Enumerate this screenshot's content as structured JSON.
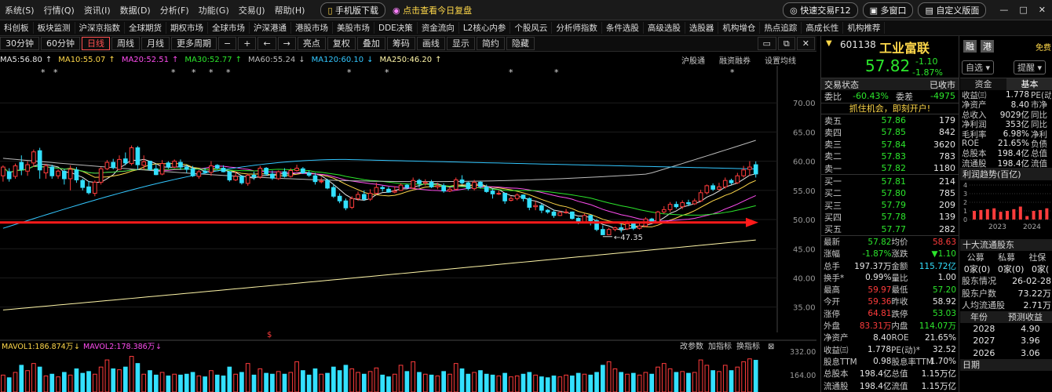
{
  "menubar": {
    "items": [
      "系统(S)",
      "行情(Q)",
      "资讯(I)",
      "数据(D)",
      "分析(F)",
      "功能(G)",
      "交易(J)",
      "帮助(H)"
    ],
    "mobile": "手机版下载",
    "review": "点击查看今日复盘",
    "quick_trade": "快速交易F12",
    "multi_window": "多窗口",
    "custom_layout": "自定义版面"
  },
  "navbar": {
    "items": [
      "科创板",
      "板块监测",
      "沪深京指数",
      "全球期货",
      "期权市场",
      "全球市场",
      "沪深港通",
      "港股市场",
      "美股市场",
      "DDE决策",
      "资金流向",
      "L2核心内参",
      "个股风云",
      "分析师指数",
      "条件选股",
      "高级选股",
      "选股器",
      "机构增仓",
      "热点追踪",
      "高成长性",
      "机构推荐"
    ]
  },
  "toolbar": {
    "periods": [
      "30分钟",
      "60分钟",
      "日线",
      "周线",
      "月线",
      "更多周期"
    ],
    "selected": "日线",
    "tools": [
      "亮点",
      "复权",
      "叠加",
      "筹码",
      "画线",
      "显示",
      "简约",
      "隐藏"
    ]
  },
  "ma_legend": [
    {
      "label": "MA5:56.80",
      "color": "#e6e6e6",
      "arrow": "↑"
    },
    {
      "label": "MA10:55.07",
      "color": "#ffd84a",
      "arrow": "↑"
    },
    {
      "label": "MA20:52.51",
      "color": "#ff4df0",
      "arrow": "↑"
    },
    {
      "label": "MA30:52.77",
      "color": "#2ce62c",
      "arrow": "↑"
    },
    {
      "label": "MA60:55.24",
      "color": "#bbbbbb",
      "arrow": "↓"
    },
    {
      "label": "MA120:60.10",
      "color": "#33c7ff",
      "arrow": "↓"
    },
    {
      "label": "MA250:46.20",
      "color": "#fff6a8",
      "arrow": "↑"
    }
  ],
  "chart_links": [
    "沪股通",
    "融资融券",
    "设置均线"
  ],
  "vol_legend": [
    {
      "label": "MAVOL1:186.874万",
      "color": "#ffd84a",
      "arrow": "↓"
    },
    {
      "label": "MAVOL2:178.386万",
      "color": "#ff4df0",
      "arrow": "↓"
    }
  ],
  "vol_tools": [
    "改参数",
    "加指标",
    "换指标"
  ],
  "chart_data": {
    "type": "candlestick",
    "price_axis": {
      "ticks": [
        "70.00",
        "65.00",
        "60.00",
        "55.00",
        "50.00",
        "45.00",
        "40.00",
        "35.00"
      ],
      "range": [
        32,
        75
      ]
    },
    "vol_axis": {
      "ticks": [
        "332.00",
        "164.00"
      ]
    },
    "min_label": "47.35",
    "horizontal_line": 49.5,
    "candles": [
      [
        57.5,
        59,
        56.5,
        59.3
      ],
      [
        58.2,
        57,
        56.5,
        58.8
      ],
      [
        57.4,
        59.2,
        57,
        59.6
      ],
      [
        59.8,
        58.6,
        57.6,
        61
      ],
      [
        58.3,
        59.4,
        57.5,
        60
      ],
      [
        59.7,
        61.6,
        59,
        62
      ],
      [
        61.8,
        58.5,
        57,
        62.3
      ],
      [
        58,
        59.2,
        57,
        59.5
      ],
      [
        59,
        57.5,
        57,
        59.4
      ],
      [
        57.5,
        58.3,
        57,
        58.6
      ],
      [
        58.3,
        57,
        56,
        58.7
      ],
      [
        57,
        58.6,
        55,
        59.3
      ],
      [
        58.5,
        56.8,
        56.3,
        59
      ],
      [
        56.7,
        55.5,
        55,
        57
      ],
      [
        55.6,
        54.6,
        54.3,
        56.6
      ],
      [
        54.5,
        56.4,
        54,
        56.7
      ],
      [
        56.4,
        58.7,
        56,
        59
      ],
      [
        58.7,
        59.8,
        58.5,
        60.2
      ],
      [
        59.8,
        58.9,
        58.6,
        60.4
      ],
      [
        58.6,
        60.3,
        58.5,
        61
      ],
      [
        60.4,
        59.7,
        59.3,
        61.5
      ],
      [
        59.6,
        62.3,
        59.3,
        62.7
      ],
      [
        62.3,
        59.4,
        58.6,
        62.6
      ],
      [
        59.3,
        59.9,
        58.5,
        61
      ],
      [
        60,
        58.6,
        58.4,
        60.1
      ],
      [
        58.7,
        57.7,
        57.6,
        59.5
      ],
      [
        57.8,
        59.6,
        57.6,
        60.2
      ],
      [
        59.7,
        59,
        58.7,
        60
      ],
      [
        59,
        60,
        58.8,
        60.3
      ],
      [
        59.8,
        59,
        58.5,
        60.3
      ],
      [
        59,
        58.6,
        58,
        59.4
      ],
      [
        58.7,
        57.5,
        57.3,
        59.2
      ],
      [
        57.4,
        58.2,
        57,
        58.5
      ],
      [
        58.3,
        58.1,
        57.9,
        58.9
      ],
      [
        58.1,
        59.2,
        57.5,
        60
      ],
      [
        59.3,
        58.8,
        58.6,
        59.5
      ],
      [
        58.8,
        58.2,
        58.1,
        59.3
      ],
      [
        58.2,
        56.8,
        56.5,
        58.3
      ],
      [
        56.8,
        57.4,
        56.6,
        58.2
      ],
      [
        57.4,
        56.3,
        56,
        57.6
      ],
      [
        56.2,
        57.6,
        55.8,
        57.8
      ],
      [
        57.6,
        57.3,
        56.8,
        58.2
      ],
      [
        57.3,
        58.8,
        57,
        59.2
      ],
      [
        58.8,
        57.8,
        57.5,
        59
      ],
      [
        57.8,
        57.1,
        56.8,
        58.4
      ],
      [
        57,
        58.2,
        56.8,
        58.4
      ],
      [
        58.2,
        57.4,
        57.2,
        58.8
      ],
      [
        57.4,
        58.4,
        57.2,
        58.8
      ],
      [
        58.4,
        58.8,
        58.2,
        59.4
      ],
      [
        58.7,
        58,
        57.8,
        59
      ],
      [
        58,
        57.6,
        57.3,
        58.4
      ],
      [
        57.5,
        56.5,
        56,
        58
      ],
      [
        56.6,
        56.6,
        56.2,
        57.2
      ],
      [
        56.7,
        55.4,
        55.2,
        57
      ],
      [
        55.5,
        54,
        53.7,
        56
      ],
      [
        54,
        53.2,
        52.8,
        54.5
      ],
      [
        53.2,
        52,
        51.6,
        53.6
      ],
      [
        52.1,
        53.6,
        51.8,
        54
      ],
      [
        53.6,
        54.3,
        53.2,
        54.8
      ],
      [
        54.3,
        53.5,
        53.2,
        55
      ],
      [
        53.5,
        54.5,
        53.2,
        55.2
      ],
      [
        54.5,
        55.5,
        54.3,
        56.3
      ],
      [
        55.5,
        55.3,
        54.8,
        55.8
      ],
      [
        55.2,
        54.7,
        54.6,
        55.6
      ],
      [
        54.7,
        54.9,
        54.5,
        55.7
      ],
      [
        55,
        55.9,
        54.9,
        56.2
      ],
      [
        55.9,
        55.5,
        55.2,
        56.1
      ],
      [
        55.4,
        56.7,
        55.3,
        57.2
      ],
      [
        56.7,
        56.2,
        55.5,
        57
      ],
      [
        56.2,
        56.4,
        55.8,
        56.9
      ],
      [
        56.4,
        55.6,
        55.4,
        56.8
      ],
      [
        55.6,
        55.8,
        55.2,
        56.3
      ],
      [
        55.8,
        54.9,
        54.6,
        56.2
      ],
      [
        54.9,
        55.2,
        54.7,
        55.6
      ],
      [
        55.2,
        56.8,
        55,
        57.2
      ],
      [
        56.8,
        56.3,
        56,
        57.6
      ],
      [
        56.3,
        55.3,
        55,
        56.5
      ],
      [
        55.3,
        56.4,
        55,
        56.8
      ],
      [
        56.4,
        55.7,
        55.3,
        56.6
      ],
      [
        55.6,
        54.8,
        54.6,
        56
      ],
      [
        54.9,
        54.4,
        53.6,
        55.2
      ],
      [
        54.4,
        54.5,
        54.2,
        55
      ],
      [
        54.5,
        53.2,
        52.7,
        54.6
      ],
      [
        53.3,
        53.6,
        53.1,
        54
      ],
      [
        53.6,
        54.2,
        53.3,
        54.5
      ],
      [
        54.2,
        53.6,
        53.1,
        54.3
      ],
      [
        53.6,
        52.1,
        51.6,
        53.8
      ],
      [
        52.2,
        52.4,
        51.6,
        53.2
      ],
      [
        52.4,
        51.6,
        51.1,
        52.7
      ],
      [
        51.6,
        51.3,
        51,
        51.8
      ],
      [
        51.3,
        50.7,
        50.3,
        51.7
      ],
      [
        50.7,
        51.2,
        50.6,
        51.5
      ],
      [
        51.3,
        51.3,
        51,
        51.8
      ],
      [
        51.3,
        50.2,
        50,
        51.4
      ],
      [
        50.2,
        49.6,
        49.2,
        50.4
      ],
      [
        49.6,
        50.7,
        49.5,
        51
      ],
      [
        50.7,
        49.8,
        49,
        50.8
      ],
      [
        49.8,
        48.3,
        48,
        50.1
      ],
      [
        48.3,
        47.4,
        47.35,
        49
      ],
      [
        47.4,
        48.3,
        47.35,
        48.6
      ],
      [
        48.3,
        48.6,
        48,
        48.8
      ],
      [
        48.6,
        48.4,
        47.8,
        49.4
      ],
      [
        48.4,
        49.3,
        48.2,
        49.8
      ],
      [
        49.3,
        48.5,
        48.2,
        49.6
      ],
      [
        48.5,
        48.9,
        48.3,
        49.4
      ],
      [
        48.9,
        50.1,
        48.7,
        50.4
      ],
      [
        50.1,
        49.6,
        49.3,
        50.3
      ],
      [
        49.6,
        51.3,
        49.4,
        51.5
      ],
      [
        51.3,
        51.7,
        51,
        52.3
      ],
      [
        51.7,
        52.6,
        51.3,
        53
      ],
      [
        52.6,
        52.2,
        51.9,
        53.1
      ],
      [
        52.2,
        52.9,
        51.8,
        53.3
      ],
      [
        52.9,
        52.7,
        52.3,
        53.4
      ],
      [
        52.7,
        53.2,
        52.5,
        53.6
      ],
      [
        53.2,
        54.6,
        53,
        55.1
      ],
      [
        54.6,
        55.8,
        54.3,
        56
      ],
      [
        55.8,
        55.2,
        54.9,
        56.2
      ],
      [
        55.2,
        55.6,
        55,
        56.3
      ],
      [
        55.6,
        56.7,
        55.3,
        57.2
      ],
      [
        56.7,
        56.3,
        56,
        57
      ],
      [
        56.3,
        57.5,
        56.1,
        58
      ],
      [
        57.5,
        58.5,
        57.2,
        59.2
      ],
      [
        58.6,
        59,
        57.5,
        60
      ],
      [
        59.4,
        57.82,
        57.2,
        59.97
      ]
    ],
    "volumes": [
      95,
      80,
      110,
      150,
      120,
      160,
      140,
      90,
      100,
      85,
      110,
      95,
      130,
      105,
      115,
      100,
      140,
      180,
      130,
      125,
      140,
      200,
      160,
      100,
      120,
      95,
      110,
      90,
      100,
      95,
      100,
      110,
      90,
      85,
      120,
      95,
      90,
      140,
      100,
      110,
      160,
      95,
      130,
      105,
      100,
      115,
      100,
      110,
      170,
      120,
      95,
      130,
      100,
      105,
      140,
      120,
      150,
      130,
      110,
      100,
      115,
      135,
      95,
      85,
      100,
      150,
      115,
      170,
      110,
      100,
      95,
      90,
      115,
      100,
      160,
      130,
      100,
      110,
      120,
      100,
      95,
      90,
      105,
      85,
      90,
      100,
      110,
      95,
      85,
      80,
      90,
      85,
      95,
      90,
      105,
      100,
      95,
      110,
      150,
      170,
      130,
      110,
      100,
      105,
      95,
      110,
      100,
      140,
      160,
      130,
      110,
      115,
      105,
      110,
      180,
      150,
      120,
      115,
      150,
      120,
      140,
      170,
      186,
      178
    ]
  },
  "stock": {
    "code": "601138",
    "name": "工业富联",
    "price": "57.82",
    "change": "-1.10",
    "change_pct": "-1.87%",
    "tag1": "融",
    "tag2": "港",
    "btn_self": "自选",
    "btn_alert": "提醒",
    "free": "免费"
  },
  "status": {
    "title": "交易状态",
    "value": "已收市"
  },
  "ratio": {
    "weibi_label": "委比",
    "weibi": "-60.43%",
    "weicha_label": "委差",
    "weicha": "-4975"
  },
  "banner": "抓住机会，即刻开户!",
  "sell": [
    {
      "l": "卖五",
      "p": "57.86",
      "v": "179"
    },
    {
      "l": "卖四",
      "p": "57.85",
      "v": "842"
    },
    {
      "l": "卖三",
      "p": "57.84",
      "v": "3620"
    },
    {
      "l": "卖二",
      "p": "57.83",
      "v": "783"
    },
    {
      "l": "卖一",
      "p": "57.82",
      "v": "1180"
    }
  ],
  "buy": [
    {
      "l": "买一",
      "p": "57.81",
      "v": "214"
    },
    {
      "l": "买二",
      "p": "57.80",
      "v": "785"
    },
    {
      "l": "买三",
      "p": "57.79",
      "v": "209"
    },
    {
      "l": "买四",
      "p": "57.78",
      "v": "139"
    },
    {
      "l": "买五",
      "p": "57.77",
      "v": "282"
    }
  ],
  "stats": [
    [
      {
        "l": "最新",
        "v": "57.82",
        "c": "c-green"
      },
      {
        "l": "均价",
        "v": "58.63",
        "c": "c-red"
      }
    ],
    [
      {
        "l": "涨幅",
        "v": "-1.87%",
        "c": "c-green"
      },
      {
        "l": "涨跌",
        "v": "▼1.10",
        "c": "c-green"
      }
    ],
    [
      {
        "l": "总手",
        "v": "197.37万",
        "c": "c-wh"
      },
      {
        "l": "金额",
        "v": "115.72亿",
        "c": "c-cyan"
      }
    ],
    [
      {
        "l": "换手*",
        "v": "0.99%",
        "c": "c-wh"
      },
      {
        "l": "量比",
        "v": "1.00",
        "c": "c-wh"
      }
    ],
    [
      {
        "l": "最高",
        "v": "59.97",
        "c": "c-red"
      },
      {
        "l": "最低",
        "v": "57.20",
        "c": "c-green"
      }
    ],
    [
      {
        "l": "今开",
        "v": "59.36",
        "c": "c-red"
      },
      {
        "l": "昨收",
        "v": "58.92",
        "c": "c-wh"
      }
    ],
    [
      {
        "l": "涨停",
        "v": "64.81",
        "c": "c-red"
      },
      {
        "l": "跌停",
        "v": "53.03",
        "c": "c-green"
      }
    ],
    [
      {
        "l": "外盘",
        "v": "83.31万",
        "c": "c-red"
      },
      {
        "l": "内盘",
        "v": "114.07万",
        "c": "c-green"
      }
    ],
    [
      {
        "l": "净资产",
        "v": "8.40",
        "c": "c-wh"
      },
      {
        "l": "ROE",
        "v": "21.65%",
        "c": "c-wh"
      }
    ],
    [
      {
        "l": "收益㈢",
        "v": "1.778",
        "c": "c-wh"
      },
      {
        "l": "PE(动)*",
        "v": "32.52",
        "c": "c-wh"
      }
    ],
    [
      {
        "l": "股息TTM",
        "v": "0.98",
        "c": "c-wh"
      },
      {
        "l": "股息率TTM",
        "v": "1.70%",
        "c": "c-wh"
      }
    ],
    [
      {
        "l": "总股本",
        "v": "198.4亿",
        "c": "c-wh"
      },
      {
        "l": "总值",
        "v": "1.15万亿",
        "c": "c-wh"
      }
    ],
    [
      {
        "l": "流通股",
        "v": "198.4亿",
        "c": "c-wh"
      },
      {
        "l": "流值",
        "v": "1.15万亿",
        "c": "c-wh"
      }
    ]
  ],
  "side": {
    "tabs": [
      "资金",
      "基本"
    ],
    "rows": [
      {
        "l": "收益㈢",
        "v": "1.778",
        "r": "PE(动"
      },
      {
        "l": "净资产",
        "v": "8.40",
        "r": "市净"
      },
      {
        "l": "总收入",
        "v": "9029亿",
        "r": "同比"
      },
      {
        "l": "净利润",
        "v": "353亿",
        "r": "同比"
      },
      {
        "l": "毛利率",
        "v": "6.98%",
        "r": "净利"
      },
      {
        "l": "ROE",
        "v": "21.65%",
        "r": "负债"
      },
      {
        "l": "总股本",
        "v": "198.4亿",
        "r": "总值"
      },
      {
        "l": "流通股",
        "v": "198.4亿",
        "r": "流值"
      }
    ],
    "profit_title": "利润趋势(百亿)",
    "profit_ticks": [
      "4",
      "3",
      "2",
      "1",
      "0"
    ],
    "profit_years": [
      "2023",
      "2024"
    ],
    "profit_bars": [
      1.0,
      1.1,
      1.2,
      1.3,
      0.9,
      1.0,
      1.2,
      1.5,
      0.4,
      1.0,
      1.1,
      1.3
    ],
    "top10_title": "十大流通股东",
    "top10_heads": [
      "公募",
      "私募",
      "社保"
    ],
    "top10_vals": [
      "0家(0)",
      "0家(0)",
      "0家("
    ],
    "holders": [
      {
        "l": "股东情况",
        "v": "26-02-28"
      },
      {
        "l": "股东户数",
        "v": "73.22万"
      },
      {
        "l": "人均流通股",
        "v": "2.71万"
      }
    ],
    "forecast_heads": [
      "年份",
      "预测收益"
    ],
    "forecast": [
      {
        "y": "2028",
        "v": "4.90"
      },
      {
        "y": "2027",
        "v": "3.96"
      },
      {
        "y": "2026",
        "v": "3.06"
      }
    ],
    "bottom_label": "日期"
  }
}
